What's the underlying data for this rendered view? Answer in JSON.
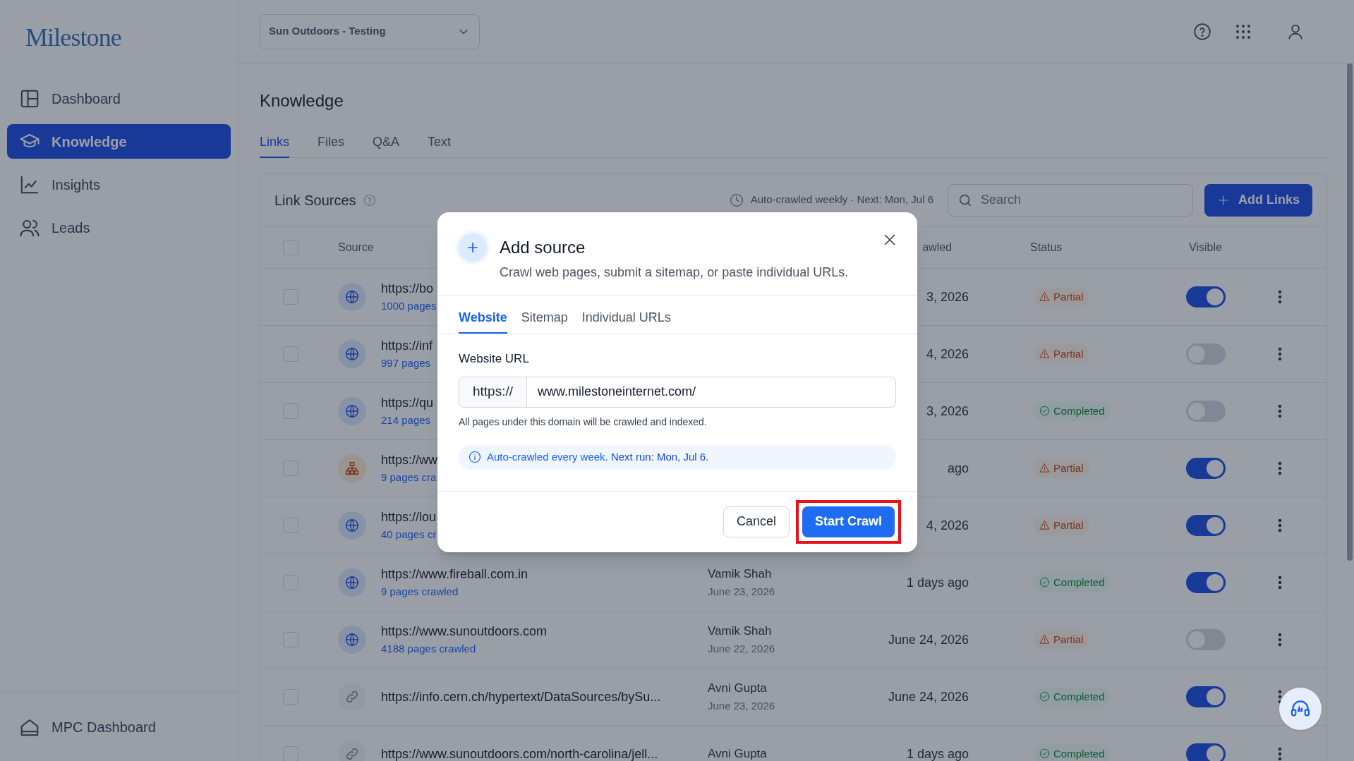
{
  "sidebar": {
    "logo": "Milestone",
    "items": [
      {
        "label": "Dashboard",
        "selected": false
      },
      {
        "label": "Knowledge",
        "selected": true
      },
      {
        "label": "Insights",
        "selected": false
      },
      {
        "label": "Leads",
        "selected": false
      }
    ],
    "footer_item": {
      "label": "MPC Dashboard"
    }
  },
  "header": {
    "workspace": "Sun Outdoors - Testing"
  },
  "page": {
    "title": "Knowledge",
    "tabs": [
      {
        "label": "Links",
        "selected": true
      },
      {
        "label": "Files",
        "selected": false
      },
      {
        "label": "Q&A",
        "selected": false
      },
      {
        "label": "Text",
        "selected": false
      }
    ]
  },
  "card": {
    "title": "Link Sources",
    "schedule": "Auto-crawled weekly · Next: Mon, Jul 6",
    "search": {
      "placeholder": "Search"
    },
    "add_button": "Add Links",
    "columns": {
      "source": "Source",
      "crawled": "awled",
      "status": "Status",
      "visible": "Visible"
    },
    "header_checked": false,
    "rows": [
      {
        "kind": "website",
        "checked": false,
        "url": "https://bo",
        "pages": "1000 pages",
        "crawled": "3, 2026",
        "status": {
          "label": "Partial",
          "kind": "partial"
        },
        "visible": true
      },
      {
        "kind": "website",
        "checked": false,
        "url": "https://inf",
        "pages": "997 pages",
        "crawled": "4, 2026",
        "status": {
          "label": "Partial",
          "kind": "partial"
        },
        "visible": false
      },
      {
        "kind": "website",
        "checked": false,
        "url": "https://qu",
        "pages": "214 pages",
        "crawled": "3, 2026",
        "status": {
          "label": "Completed",
          "kind": "completed"
        },
        "visible": false
      },
      {
        "kind": "sitemap",
        "checked": false,
        "url": "https://ww",
        "pages": "9 pages cra",
        "crawled": "ago",
        "status": {
          "label": "Partial",
          "kind": "partial"
        },
        "visible": true
      },
      {
        "kind": "website",
        "checked": false,
        "url": "https://lou",
        "pages": "40 pages cr",
        "crawled": "4, 2026",
        "status": {
          "label": "Partial",
          "kind": "partial"
        },
        "visible": true
      },
      {
        "kind": "website",
        "checked": false,
        "url": "https://www.fireball.com.in",
        "pages": "9 pages crawled",
        "added_by": "Vamik Shah",
        "added_on": "June 23, 2026",
        "crawled": "1 days ago",
        "status": {
          "label": "Completed",
          "kind": "completed"
        },
        "visible": true
      },
      {
        "kind": "website",
        "checked": false,
        "url": "https://www.sunoutdoors.com",
        "pages": "4188 pages crawled",
        "added_by": "Vamik Shah",
        "added_on": "June 22, 2026",
        "crawled": "June 24, 2026",
        "status": {
          "label": "Partial",
          "kind": "partial"
        },
        "visible": false
      },
      {
        "kind": "link",
        "checked": false,
        "url": "https://info.cern.ch/hypertext/DataSources/bySu...",
        "added_by": "Avni Gupta",
        "added_on": "June 23, 2026",
        "crawled": "June 24, 2026",
        "status": {
          "label": "Completed",
          "kind": "completed"
        },
        "visible": true
      },
      {
        "kind": "link",
        "checked": false,
        "url": "https://www.sunoutdoors.com/north-carolina/jell...",
        "added_by": "Avni Gupta",
        "crawled": "1 days ago",
        "status": {
          "label": "Completed",
          "kind": "completed"
        },
        "visible": true
      }
    ]
  },
  "dialog": {
    "title": "Add source",
    "subtitle": "Crawl web pages, submit a sitemap, or paste individual URLs.",
    "tabs": [
      {
        "label": "Website",
        "selected": true
      },
      {
        "label": "Sitemap",
        "selected": false
      },
      {
        "label": "Individual URLs",
        "selected": false
      }
    ],
    "field_label": "Website URL",
    "prefix": "https://",
    "value": "www.milestoneinternet.com/",
    "hint": "All pages under this domain will be crawled and indexed.",
    "info": "Auto-crawled every week. **Next run: Mon, Jul 6.**",
    "cancel": "Cancel",
    "submit": {
      "label": "Start Crawl",
      "highlighted": true
    }
  }
}
